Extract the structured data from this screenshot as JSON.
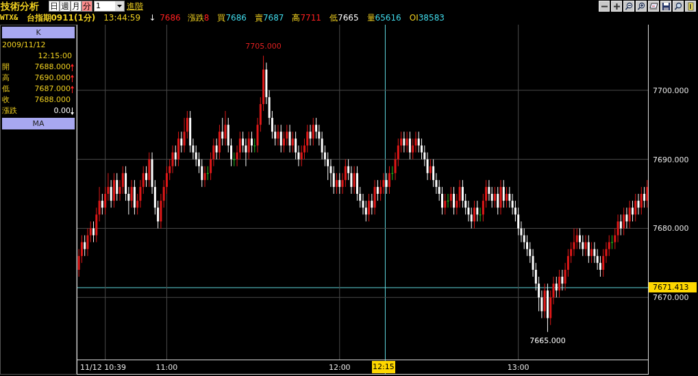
{
  "header": {
    "title": "技術分析",
    "periods": [
      {
        "label": "日",
        "selected": false
      },
      {
        "label": "週",
        "selected": false
      },
      {
        "label": "月",
        "selected": false
      },
      {
        "label": "分",
        "selected": true
      }
    ],
    "interval": "1",
    "advanced_link": "進階"
  },
  "quote": {
    "symbol": "WTX&",
    "name": "台指期0911(1分)",
    "time": "13:44:59",
    "arrow": "↓",
    "price": "7686",
    "fields": [
      {
        "label": "漲跌",
        "value": "8",
        "color": "#ff2020"
      },
      {
        "label": "買",
        "value": "7686",
        "color": "#40d8e8"
      },
      {
        "label": "賣",
        "value": "7687",
        "color": "#40d8e8"
      },
      {
        "label": "高",
        "value": "7711",
        "color": "#ff2020"
      },
      {
        "label": "低",
        "value": "7665",
        "color": "#ffffff"
      },
      {
        "label": "量",
        "value": "65616",
        "color": "#40d8e8"
      },
      {
        "label": "OI",
        "value": "38583",
        "color": "#40d8e8"
      }
    ]
  },
  "info_panel": {
    "k_header": "K",
    "date": "2009/11/12",
    "time": "12:15:00",
    "rows": [
      {
        "label": "開",
        "value": "7688.000",
        "rising": true,
        "falling": false
      },
      {
        "label": "高",
        "value": "7690.000",
        "rising": true,
        "falling": false
      },
      {
        "label": "低",
        "value": "7687.000",
        "rising": true,
        "falling": false
      },
      {
        "label": "收",
        "value": "7688.000",
        "rising": false,
        "falling": false
      },
      {
        "label": "漲跌",
        "value": "0.00",
        "rising": false,
        "falling": true
      }
    ],
    "ma_header": "MA"
  },
  "chart": {
    "cursor_x_label": "12:15",
    "chart_data": {
      "type": "candlestick",
      "ylim": [
        7661,
        7709.5
      ],
      "grid": true,
      "yticks": [
        {
          "value": 7700,
          "label": "7700.000"
        },
        {
          "value": 7690,
          "label": "7690.000"
        },
        {
          "value": 7680,
          "label": "7680.000"
        },
        {
          "value": 7670,
          "label": "7670.000"
        }
      ],
      "ref_lines": [
        {
          "axis": "y",
          "value": 7671.413,
          "label": "7671.413"
        }
      ],
      "annotations": [
        {
          "y": 7705,
          "text": "7705.000"
        },
        {
          "y": 7665,
          "text": "7665.000"
        }
      ],
      "categories": [
        null,
        null,
        null,
        null,
        null,
        null,
        null,
        null,
        null,
        "11/12 10:39",
        null,
        null,
        null,
        null,
        null,
        null,
        null,
        null,
        null,
        null,
        null,
        null,
        null,
        null,
        null,
        null,
        null,
        null,
        null,
        null,
        "11:00",
        null,
        null,
        null,
        null,
        null,
        null,
        null,
        null,
        null,
        null,
        null,
        null,
        null,
        null,
        null,
        null,
        null,
        null,
        null,
        null,
        null,
        null,
        null,
        null,
        null,
        null,
        null,
        null,
        null,
        null,
        null,
        null,
        null,
        null,
        null,
        null,
        null,
        null,
        null,
        null,
        null,
        null,
        null,
        null,
        null,
        null,
        null,
        null,
        null,
        null,
        null,
        null,
        null,
        null,
        null,
        null,
        null,
        null,
        "12:00",
        null,
        null,
        null,
        null,
        null,
        null,
        null,
        null,
        null,
        null,
        null,
        null,
        null,
        null,
        null,
        null,
        null,
        null,
        null,
        null,
        null,
        null,
        null,
        null,
        null,
        null,
        null,
        null,
        null,
        null,
        null,
        null,
        null,
        null,
        null,
        null,
        null,
        null,
        null,
        null,
        null,
        null,
        null,
        null,
        null,
        null,
        null,
        null,
        null,
        null,
        null,
        null,
        null,
        null,
        null,
        null,
        null,
        null,
        null,
        null,
        "13:00",
        null,
        null,
        null,
        null,
        null,
        null,
        null,
        null,
        null,
        null,
        null,
        null,
        null,
        null,
        null,
        null,
        null,
        null,
        null,
        null,
        null,
        null,
        null,
        null,
        null,
        null,
        null,
        null,
        null,
        null,
        null,
        null,
        null,
        null,
        null,
        null,
        null,
        null,
        null,
        null,
        null,
        null,
        null,
        null
      ],
      "ohlc": [
        [
          7674,
          7677,
          7673,
          7676
        ],
        [
          7676,
          7679,
          7675,
          7678
        ],
        [
          7678,
          7679,
          7676,
          7677
        ],
        [
          7677,
          7680,
          7676,
          7679
        ],
        [
          7679,
          7681,
          7678,
          7680
        ],
        [
          7680,
          7681,
          7678,
          7679
        ],
        [
          7679,
          7683,
          7678,
          7682
        ],
        [
          7682,
          7686,
          7681,
          7684
        ],
        [
          7684,
          7685,
          7682,
          7683
        ],
        [
          7683,
          7686,
          7682,
          7685
        ],
        [
          7685,
          7688,
          7684,
          7686
        ],
        [
          7686,
          7687,
          7683,
          7684
        ],
        [
          7684,
          7688,
          7683,
          7687
        ],
        [
          7687,
          7688,
          7684,
          7685
        ],
        [
          7685,
          7687,
          7684,
          7686
        ],
        [
          7686,
          7689,
          7685,
          7688
        ],
        [
          7688,
          7689,
          7684,
          7685
        ],
        [
          7685,
          7686,
          7682,
          7684
        ],
        [
          7684,
          7687,
          7683,
          7686
        ],
        [
          7686,
          7687,
          7682,
          7683
        ],
        [
          7683,
          7685,
          7682,
          7684
        ],
        [
          7684,
          7687,
          7683,
          7686
        ],
        [
          7686,
          7689,
          7685,
          7688
        ],
        [
          7688,
          7689,
          7686,
          7687
        ],
        [
          7687,
          7691,
          7686,
          7690
        ],
        [
          7690,
          7691,
          7685,
          7686
        ],
        [
          7686,
          7687,
          7682,
          7683
        ],
        [
          7683,
          7684,
          7680,
          7681
        ],
        [
          7681,
          7685,
          7680,
          7684
        ],
        [
          7684,
          7687,
          7683,
          7686
        ],
        [
          7686,
          7689,
          7685,
          7688
        ],
        [
          7688,
          7690,
          7687,
          7689
        ],
        [
          7689,
          7692,
          7688,
          7691
        ],
        [
          7691,
          7692,
          7689,
          7690
        ],
        [
          7690,
          7694,
          7689,
          7693
        ],
        [
          7693,
          7694,
          7691,
          7692
        ],
        [
          7692,
          7696,
          7691,
          7694
        ],
        [
          7694,
          7697,
          7693,
          7696
        ],
        [
          7696,
          7697,
          7691,
          7692
        ],
        [
          7692,
          7693,
          7690,
          7691
        ],
        [
          7691,
          7692,
          7689,
          7690
        ],
        [
          7690,
          7691,
          7688,
          7689
        ],
        [
          7689,
          7690,
          7686,
          7687
        ],
        [
          7687,
          7689,
          7686,
          7688
        ],
        [
          7688,
          7689,
          7687,
          7688
        ],
        [
          7688,
          7691,
          7687,
          7690
        ],
        [
          7690,
          7693,
          7689,
          7692
        ],
        [
          7692,
          7693,
          7690,
          7691
        ],
        [
          7691,
          7695,
          7690,
          7694
        ],
        [
          7694,
          7696,
          7692,
          7693
        ],
        [
          7693,
          7697,
          7692,
          7695
        ],
        [
          7695,
          7696,
          7691,
          7692
        ],
        [
          7692,
          7693,
          7689,
          7690
        ],
        [
          7690,
          7691,
          7689,
          7690
        ],
        [
          7690,
          7692,
          7689,
          7691
        ],
        [
          7691,
          7694,
          7690,
          7693
        ],
        [
          7693,
          7694,
          7691,
          7692
        ],
        [
          7692,
          7693,
          7689,
          7691
        ],
        [
          7691,
          7694,
          7690,
          7693
        ],
        [
          7693,
          7694,
          7691,
          7692
        ],
        [
          7692,
          7693,
          7691,
          7692
        ],
        [
          7692,
          7696,
          7691,
          7695
        ],
        [
          7695,
          7699,
          7694,
          7698
        ],
        [
          7698,
          7705,
          7697,
          7703
        ],
        [
          7703,
          7704,
          7698,
          7699
        ],
        [
          7699,
          7700,
          7695,
          7696
        ],
        [
          7696,
          7697,
          7693,
          7694
        ],
        [
          7694,
          7695,
          7692,
          7693
        ],
        [
          7693,
          7695,
          7692,
          7694
        ],
        [
          7694,
          7695,
          7691,
          7692
        ],
        [
          7692,
          7694,
          7691,
          7693
        ],
        [
          7693,
          7695,
          7692,
          7694
        ],
        [
          7694,
          7695,
          7691,
          7692
        ],
        [
          7692,
          7694,
          7691,
          7693
        ],
        [
          7693,
          7694,
          7690,
          7691
        ],
        [
          7691,
          7692,
          7689,
          7690
        ],
        [
          7690,
          7692,
          7689,
          7691
        ],
        [
          7691,
          7693,
          7690,
          7692
        ],
        [
          7692,
          7695,
          7691,
          7694
        ],
        [
          7694,
          7695,
          7692,
          7693
        ],
        [
          7693,
          7696,
          7692,
          7695
        ],
        [
          7695,
          7696,
          7693,
          7694
        ],
        [
          7694,
          7695,
          7692,
          7693
        ],
        [
          7693,
          7694,
          7690,
          7691
        ],
        [
          7691,
          7692,
          7689,
          7690
        ],
        [
          7690,
          7691,
          7687,
          7689
        ],
        [
          7689,
          7690,
          7686,
          7688
        ],
        [
          7688,
          7689,
          7685,
          7686
        ],
        [
          7686,
          7688,
          7685,
          7687
        ],
        [
          7687,
          7688,
          7685,
          7686
        ],
        [
          7686,
          7688,
          7685,
          7687
        ],
        [
          7687,
          7690,
          7686,
          7689
        ],
        [
          7689,
          7690,
          7687,
          7688
        ],
        [
          7688,
          7689,
          7685,
          7686
        ],
        [
          7686,
          7689,
          7685,
          7688
        ],
        [
          7688,
          7689,
          7684,
          7685
        ],
        [
          7685,
          7686,
          7683,
          7684
        ],
        [
          7684,
          7685,
          7682,
          7683
        ],
        [
          7683,
          7684,
          7681,
          7682
        ],
        [
          7682,
          7685,
          7681,
          7684
        ],
        [
          7684,
          7685,
          7682,
          7683
        ],
        [
          7683,
          7687,
          7682,
          7686
        ],
        [
          7686,
          7687,
          7684,
          7685
        ],
        [
          7685,
          7687,
          7684,
          7686
        ],
        [
          7686,
          7688,
          7685,
          7687
        ],
        [
          7687,
          7688,
          7685,
          7686
        ],
        [
          7686,
          7689,
          7685,
          7688
        ],
        [
          7688,
          7689,
          7687,
          7688
        ],
        [
          7688,
          7691,
          7687,
          7690
        ],
        [
          7690,
          7693,
          7689,
          7692
        ],
        [
          7692,
          7694,
          7691,
          7693
        ],
        [
          7693,
          7694,
          7691,
          7692
        ],
        [
          7692,
          7694,
          7691,
          7693
        ],
        [
          7693,
          7694,
          7690,
          7691
        ],
        [
          7691,
          7693,
          7690,
          7692
        ],
        [
          7692,
          7694,
          7691,
          7693
        ],
        [
          7693,
          7694,
          7691,
          7692
        ],
        [
          7692,
          7693,
          7690,
          7691
        ],
        [
          7691,
          7692,
          7689,
          7690
        ],
        [
          7690,
          7691,
          7687,
          7688
        ],
        [
          7688,
          7690,
          7687,
          7689
        ],
        [
          7689,
          7690,
          7686,
          7687
        ],
        [
          7687,
          7688,
          7685,
          7686
        ],
        [
          7686,
          7687,
          7684,
          7685
        ],
        [
          7685,
          7686,
          7682,
          7683
        ],
        [
          7683,
          7685,
          7682,
          7684
        ],
        [
          7684,
          7685,
          7683,
          7684
        ],
        [
          7684,
          7686,
          7683,
          7685
        ],
        [
          7685,
          7686,
          7682,
          7683
        ],
        [
          7683,
          7685,
          7682,
          7684
        ],
        [
          7684,
          7687,
          7683,
          7686
        ],
        [
          7686,
          7687,
          7683,
          7684
        ],
        [
          7684,
          7685,
          7682,
          7683
        ],
        [
          7683,
          7684,
          7681,
          7682
        ],
        [
          7682,
          7683,
          7680,
          7681
        ],
        [
          7681,
          7684,
          7680,
          7683
        ],
        [
          7683,
          7684,
          7681,
          7682
        ],
        [
          7682,
          7683,
          7681,
          7682
        ],
        [
          7682,
          7685,
          7681,
          7684
        ],
        [
          7684,
          7687,
          7683,
          7686
        ],
        [
          7686,
          7687,
          7684,
          7685
        ],
        [
          7685,
          7686,
          7683,
          7684
        ],
        [
          7684,
          7686,
          7683,
          7685
        ],
        [
          7685,
          7686,
          7682,
          7683
        ],
        [
          7683,
          7687,
          7682,
          7686
        ],
        [
          7686,
          7687,
          7683,
          7684
        ],
        [
          7684,
          7686,
          7683,
          7685
        ],
        [
          7685,
          7686,
          7683,
          7684
        ],
        [
          7684,
          7685,
          7682,
          7683
        ],
        [
          7683,
          7684,
          7681,
          7682
        ],
        [
          7682,
          7683,
          7679,
          7680
        ],
        [
          7680,
          7681,
          7678,
          7679
        ],
        [
          7679,
          7680,
          7677,
          7678
        ],
        [
          7678,
          7679,
          7676,
          7677
        ],
        [
          7677,
          7678,
          7675,
          7676
        ],
        [
          7676,
          7677,
          7673,
          7674
        ],
        [
          7674,
          7675,
          7671,
          7672
        ],
        [
          7672,
          7673,
          7668,
          7670
        ],
        [
          7670,
          7671,
          7667,
          7668
        ],
        [
          7668,
          7672,
          7667,
          7671
        ],
        [
          7671,
          7672,
          7665,
          7667
        ],
        [
          7667,
          7671,
          7666,
          7670
        ],
        [
          7670,
          7673,
          7669,
          7672
        ],
        [
          7672,
          7673,
          7670,
          7671
        ],
        [
          7671,
          7674,
          7670,
          7673
        ],
        [
          7673,
          7674,
          7671,
          7672
        ],
        [
          7672,
          7675,
          7671,
          7674
        ],
        [
          7674,
          7677,
          7673,
          7676
        ],
        [
          7676,
          7678,
          7675,
          7677
        ],
        [
          7677,
          7680,
          7676,
          7678
        ],
        [
          7678,
          7680,
          7677,
          7679
        ],
        [
          7679,
          7680,
          7677,
          7678
        ],
        [
          7678,
          7679,
          7676,
          7677
        ],
        [
          7677,
          7679,
          7676,
          7678
        ],
        [
          7678,
          7679,
          7675,
          7676
        ],
        [
          7676,
          7678,
          7675,
          7677
        ],
        [
          7677,
          7678,
          7675,
          7676
        ],
        [
          7676,
          7677,
          7674,
          7675
        ],
        [
          7675,
          7676,
          7673,
          7674
        ],
        [
          7674,
          7677,
          7673,
          7676
        ],
        [
          7676,
          7678,
          7675,
          7677
        ],
        [
          7677,
          7679,
          7676,
          7678
        ],
        [
          7678,
          7679,
          7677,
          7678
        ],
        [
          7678,
          7680,
          7677,
          7679
        ],
        [
          7679,
          7682,
          7678,
          7681
        ],
        [
          7681,
          7682,
          7679,
          7680
        ],
        [
          7680,
          7683,
          7679,
          7682
        ],
        [
          7682,
          7683,
          7680,
          7681
        ],
        [
          7681,
          7684,
          7680,
          7683
        ],
        [
          7683,
          7684,
          7681,
          7682
        ],
        [
          7682,
          7685,
          7681,
          7684
        ],
        [
          7684,
          7685,
          7682,
          7683
        ],
        [
          7683,
          7686,
          7682,
          7685
        ],
        [
          7685,
          7686,
          7683,
          7684
        ],
        [
          7684,
          7687,
          7683,
          7686
        ]
      ]
    }
  }
}
